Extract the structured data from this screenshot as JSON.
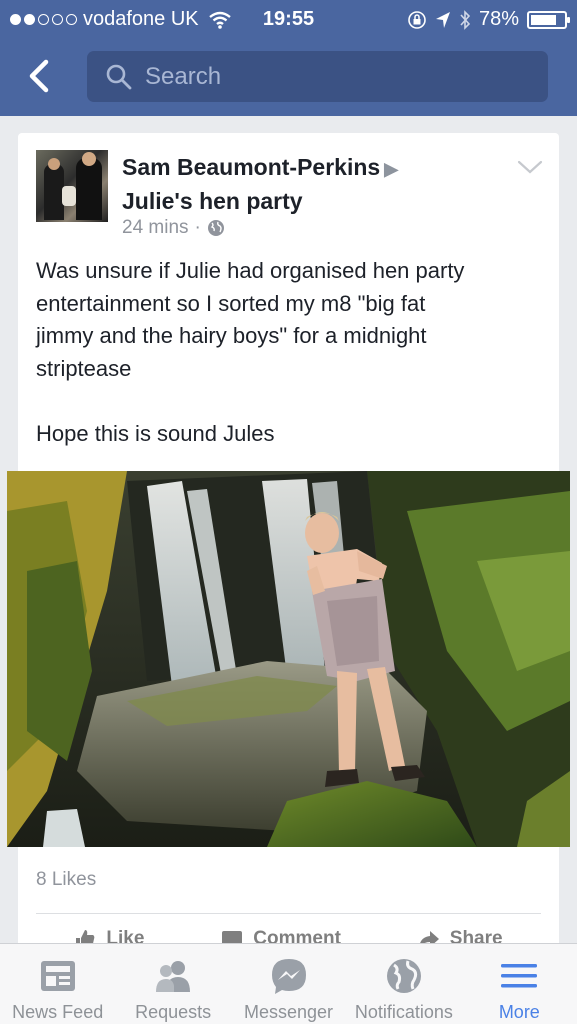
{
  "status_bar": {
    "signal_bars": 5,
    "signal_filled": 2,
    "carrier": "vodafone UK",
    "time": "19:55",
    "battery": "78%",
    "battery_level": 0.78
  },
  "nav": {
    "search_placeholder": "Search"
  },
  "post": {
    "author": "Sam Beaumont-Perkins",
    "target": "Julie's hen party",
    "time": "24 mins",
    "privacy_icon": "globe-icon",
    "text_lines": [
      "Was unsure if Julie had organised hen party",
      "entertainment so I sorted my m8 \"big fat",
      "jimmy and the hairy boys\" for a midnight",
      "striptease",
      "",
      "Hope this is sound Jules"
    ],
    "likes": "8 Likes",
    "actions": [
      {
        "label": "Like",
        "icon": "thumbs-up-icon"
      },
      {
        "label": "Comment",
        "icon": "comment-icon"
      },
      {
        "label": "Share",
        "icon": "share-icon"
      }
    ]
  },
  "tabs": [
    {
      "label": "News Feed",
      "icon": "news-feed-icon",
      "active": false
    },
    {
      "label": "Requests",
      "icon": "friend-requests-icon",
      "active": false
    },
    {
      "label": "Messenger",
      "icon": "messenger-icon",
      "active": false
    },
    {
      "label": "Notifications",
      "icon": "globe-icon",
      "active": false
    },
    {
      "label": "More",
      "icon": "menu-icon",
      "active": true
    }
  ],
  "colors": {
    "header": "#4a66a0",
    "search_bg": "#3b5284",
    "active_tab": "#4a81e6",
    "inactive_tab": "#8e9297",
    "page_bg": "#e9ebee"
  }
}
